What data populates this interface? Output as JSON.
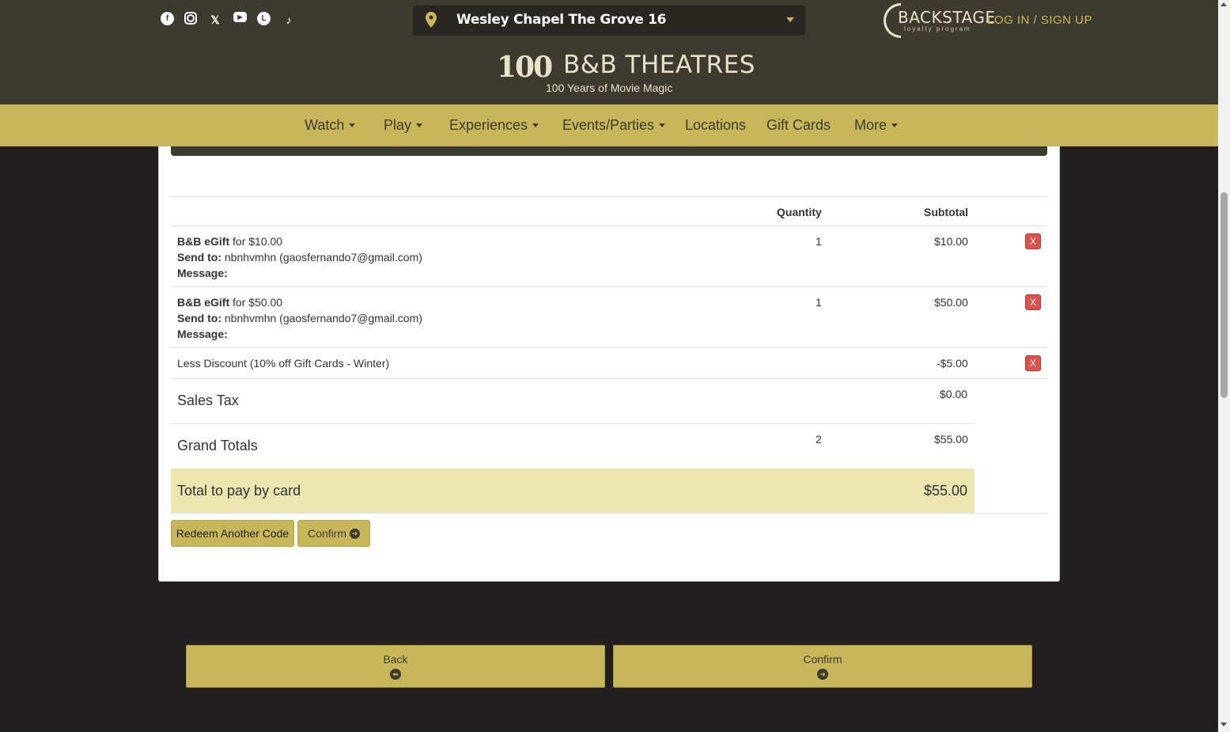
{
  "header": {
    "socials": [
      {
        "icon": "facebook-icon",
        "glyph": "f"
      },
      {
        "icon": "instagram-icon",
        "glyph": ""
      },
      {
        "icon": "x-twitter-icon",
        "glyph": "𝕏"
      },
      {
        "icon": "youtube-icon",
        "glyph": "▶"
      },
      {
        "icon": "letterboxd-icon",
        "glyph": "L"
      },
      {
        "icon": "tiktok-icon",
        "glyph": "♪"
      }
    ],
    "location": "Wesley Chapel The Grove 16",
    "backstage_main": "BACKSTAGE",
    "backstage_sub": "loyalty program",
    "login_label": "LOG IN / SIGN UP",
    "brand_100": "100",
    "brand_name": "B&B THEATRES",
    "brand_tagline": "100 Years of Movie Magic"
  },
  "nav": {
    "watch": "Watch",
    "play": "Play",
    "experiences": "Experiences",
    "events": "Events/Parties",
    "locations": "Locations",
    "gift_cards": "Gift Cards",
    "more": "More"
  },
  "cart": {
    "col_quantity": "Quantity",
    "col_subtotal": "Subtotal",
    "items": [
      {
        "name": "B&B eGift",
        "for_text": " for $10.00",
        "send_to_label": "Send to:",
        "send_to_value": " nbnhvmhn (gaosfernando7@gmail.com)",
        "message_label": "Message:",
        "quantity": "1",
        "subtotal": "$10.00",
        "remove": "X"
      },
      {
        "name": "B&B eGift",
        "for_text": " for $50.00",
        "send_to_label": "Send to:",
        "send_to_value": " nbnhvmhn (gaosfernando7@gmail.com)",
        "message_label": "Message:",
        "quantity": "1",
        "subtotal": "$50.00",
        "remove": "X"
      }
    ],
    "discount_label": "Less Discount (10% off Gift Cards - Winter)",
    "discount_value": "-$5.00",
    "discount_remove": "X",
    "sales_tax_label": "Sales Tax",
    "sales_tax_value": "$0.00",
    "grand_totals_label": "Grand Totals",
    "grand_totals_qty": "2",
    "grand_totals_value": "$55.00",
    "total_card_label": "Total to pay by card",
    "total_card_value": "$55.00",
    "redeem_label": "Redeem Another Code",
    "confirm_label": "Confirm"
  },
  "footer_buttons": {
    "back": "Back",
    "confirm": "Confirm"
  },
  "colors": {
    "header_bg": "#3d3a30",
    "nav_bg": "#c8b75a",
    "page_bg": "#231f20",
    "total_row_bg": "#ebe5b0",
    "remove_red": "#d9534f"
  }
}
